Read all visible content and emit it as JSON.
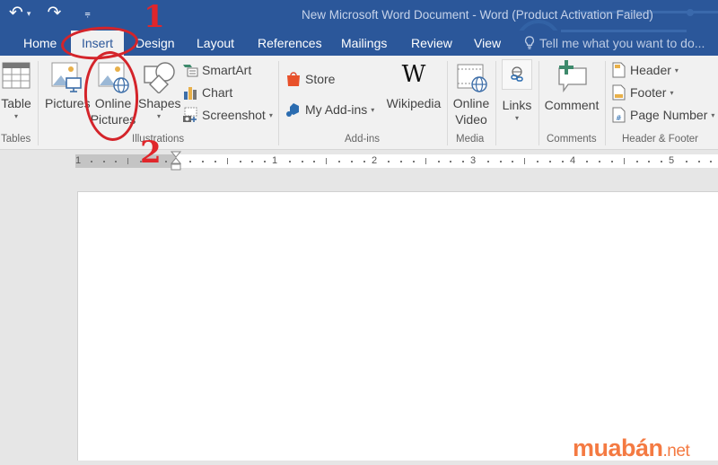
{
  "window": {
    "title": "New Microsoft Word Document - Word (Product Activation Failed)"
  },
  "quick_access": {
    "undo_icon": "undo-icon",
    "redo_icon": "redo-icon",
    "customize_icon": "customize-qat-icon",
    "undo_glyph": "↶",
    "redo_glyph": "↷",
    "dropdown_glyph": "▾",
    "customize_glyph": "⩦"
  },
  "tabs": [
    {
      "label": "Home",
      "active": false
    },
    {
      "label": "Insert",
      "active": true
    },
    {
      "label": "Design",
      "active": false
    },
    {
      "label": "Layout",
      "active": false
    },
    {
      "label": "References",
      "active": false
    },
    {
      "label": "Mailings",
      "active": false
    },
    {
      "label": "Review",
      "active": false
    },
    {
      "label": "View",
      "active": false
    }
  ],
  "tell_me": {
    "placeholder": "Tell me what you want to do..."
  },
  "ribbon": {
    "groups": {
      "tables": {
        "label": "Tables",
        "table": "Table"
      },
      "illustrations": {
        "label": "Illustrations",
        "pictures": "Pictures",
        "online_pictures_line1": "Online",
        "online_pictures_line2": "Pictures",
        "shapes": "Shapes",
        "smartart": "SmartArt",
        "chart": "Chart",
        "screenshot": "Screenshot"
      },
      "addins": {
        "label": "Add-ins",
        "store": "Store",
        "my_addins": "My Add-ins",
        "wikipedia": "Wikipedia",
        "wikipedia_glyph": "W"
      },
      "media": {
        "label": "Media",
        "online_video_line1": "Online",
        "online_video_line2": "Video"
      },
      "links": {
        "label": "Links"
      },
      "comments": {
        "label": "Comments",
        "comment": "Comment"
      },
      "header_footer": {
        "label": "Header & Footer",
        "header": "Header",
        "footer": "Footer",
        "page_number": "Page Number"
      }
    },
    "dropdown_glyph": "▾"
  },
  "ruler": {
    "numbers": [
      "1",
      "1",
      "2",
      "3",
      "4",
      "5"
    ]
  },
  "annotations": {
    "step1": "1",
    "step2": "2",
    "color": "#e0262b"
  },
  "watermark": {
    "brand": "muabán",
    "suffix": ".net",
    "color": "#f47a42"
  },
  "colors": {
    "word_blue": "#2b579a",
    "ribbon_bg": "#f1f1f1"
  }
}
